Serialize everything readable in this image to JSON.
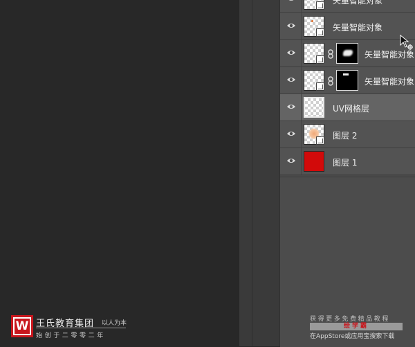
{
  "layers": [
    {
      "name": "矢量智能对象",
      "type": "smart-object",
      "mask": null,
      "selected": false
    },
    {
      "name": "矢量智能对象",
      "type": "smart-object",
      "mask": null,
      "selected": false
    },
    {
      "name": "矢量智能对象",
      "type": "smart-object",
      "mask": "blob",
      "selected": false
    },
    {
      "name": "矢量智能对象",
      "type": "smart-object",
      "mask": "bar",
      "selected": false
    },
    {
      "name": "UV网格层",
      "type": "pixel",
      "mask": null,
      "selected": true
    },
    {
      "name": "图层 2",
      "type": "smart-object",
      "mask": null,
      "selected": false
    },
    {
      "name": "图层 1",
      "type": "solid",
      "mask": null,
      "selected": false,
      "color": "#d20a0a"
    }
  ],
  "brand": {
    "logo_letter": "W",
    "name": "王氏教育集团",
    "motto": "以人为本",
    "founded": "始创于二零零二年"
  },
  "promo": {
    "line1": "获得更多免费精品教程",
    "app_name": "绘学霸",
    "line2": "在AppStore或应用宝搜索下载"
  }
}
